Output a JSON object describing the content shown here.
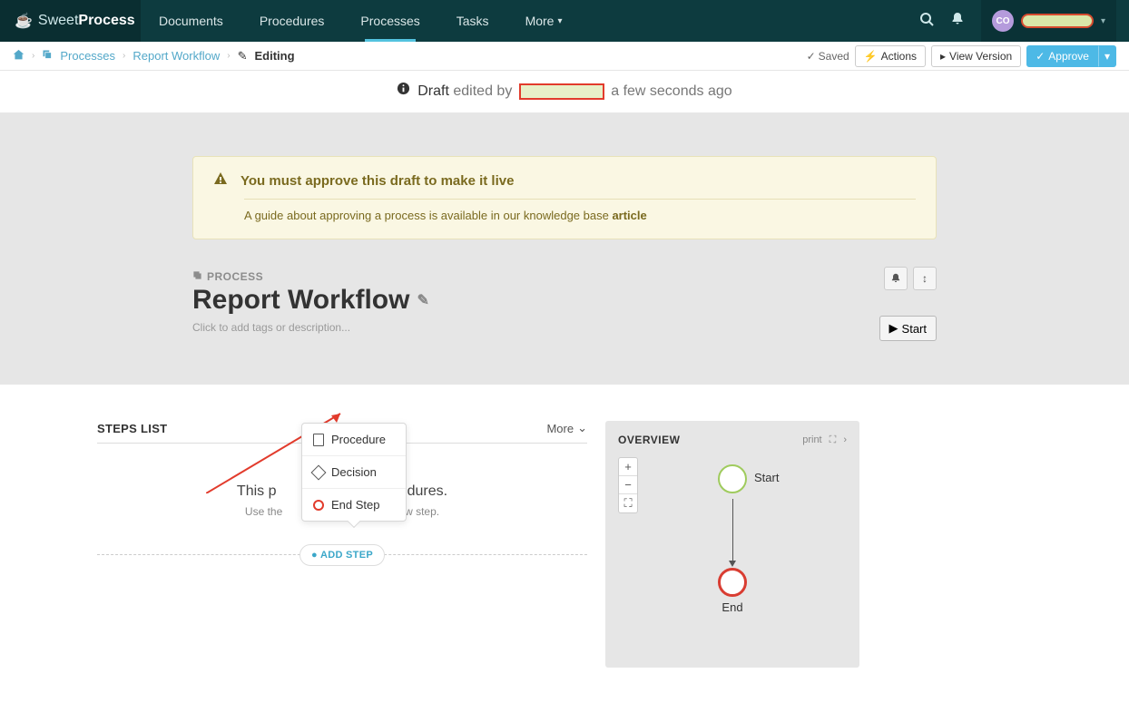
{
  "brand": {
    "text1": "Sweet",
    "text2": "Process"
  },
  "nav": {
    "documents": "Documents",
    "procedures": "Procedures",
    "processes": "Processes",
    "tasks": "Tasks",
    "more": "More"
  },
  "user": {
    "initials": "CO"
  },
  "breadcrumb": {
    "processes": "Processes",
    "item": "Report Workflow",
    "editing": "Editing"
  },
  "actions": {
    "saved": "Saved",
    "actions": "Actions",
    "view_version": "View Version",
    "approve": "Approve"
  },
  "draft": {
    "label": "Draft",
    "edited_by": "edited by",
    "ago": "a few seconds ago"
  },
  "alert": {
    "title": "You must approve this draft to make it live",
    "body": "A guide about approving a process is available in our knowledge base ",
    "link": "article"
  },
  "process": {
    "tag": "PROCESS",
    "title": "Report Workflow",
    "hint": "Click to add tags or description...",
    "start": "Start"
  },
  "steps": {
    "title": "STEPS LIST",
    "more": "More",
    "empty1": "This process has no procedures.",
    "empty2": "Use the button below to add a new step.",
    "addstep": "ADD STEP"
  },
  "popup": {
    "procedure": "Procedure",
    "decision": "Decision",
    "endstep": "End Step"
  },
  "overview": {
    "title": "OVERVIEW",
    "print": "print",
    "start": "Start",
    "end": "End",
    "zoom_in": "+",
    "zoom_out": "−",
    "full": "⛶"
  }
}
